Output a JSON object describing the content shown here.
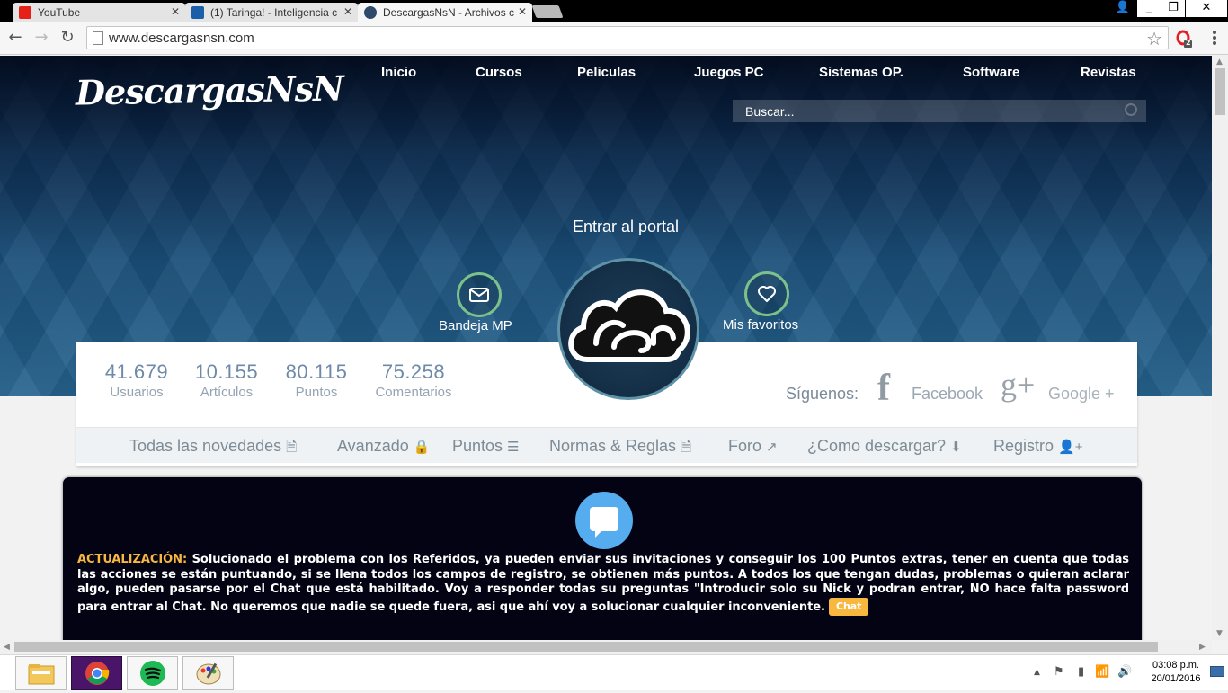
{
  "browser": {
    "tabs": [
      {
        "label": "YouTube",
        "favicon_color": "#e62117"
      },
      {
        "label": "(1) Taringa! - Inteligencia c",
        "favicon_color": "#1a5fa8"
      },
      {
        "label": "DescargasNsN - Archivos c",
        "favicon_color": "#2f4a6b"
      }
    ],
    "url": "www.descargasnsn.com",
    "extension_badge": "2"
  },
  "site": {
    "logo": "DescargasNsN",
    "nav": [
      "Inicio",
      "Cursos",
      "Peliculas",
      "Juegos PC",
      "Sistemas OP.",
      "Software",
      "Revistas"
    ],
    "search_placeholder": "Buscar...",
    "hero_title": "Entrar al portal",
    "hero_left_label": "Bandeja MP",
    "hero_right_label": "Mis favoritos",
    "accent": "#7cc08a"
  },
  "stats": [
    {
      "value": "41.679",
      "label": "Usuarios"
    },
    {
      "value": "10.155",
      "label": "Artículos"
    },
    {
      "value": "80.115",
      "label": "Puntos"
    },
    {
      "value": "75.258",
      "label": "Comentarios"
    }
  ],
  "social": {
    "follow": "Síguenos:",
    "facebook_icon": "f",
    "facebook": "Facebook",
    "google_icon": "g+",
    "google": "Google +"
  },
  "subnav": [
    {
      "label": "Todas las novedades",
      "glyph": "🗎"
    },
    {
      "label": "Avanzado",
      "glyph": "🔒"
    },
    {
      "label": "Puntos",
      "glyph": "☰"
    },
    {
      "label": "Normas & Reglas",
      "glyph": "🗎"
    },
    {
      "label": "Foro",
      "glyph": "↗"
    },
    {
      "label": "¿Como descargar?",
      "glyph": "⬇"
    },
    {
      "label": "Registro",
      "glyph": "👤+"
    }
  ],
  "notice": {
    "heading": "ACTUALIZACIÓN:",
    "body": " Solucionado el problema con los Referidos, ya pueden enviar sus invitaciones y conseguir los 100 Puntos extras, tener en cuenta que todas las acciones se están puntuando, si se llena todos los campos de registro, se obtienen más puntos. A todos los que tengan dudas, problemas o quieran aclarar algo, pueden pasarse por el Chat que está habilitado. Voy a responder todas su preguntas \"Introducir solo su Nick y podran entrar, NO hace falta password para entrar al Chat. No queremos que nadie se quede fuera, asi que ahí voy a solucionar cualquier inconveniente.",
    "chat_button": "Chat",
    "highlight_color": "#f8b840"
  },
  "taskbar": {
    "apps": [
      "file-explorer-icon",
      "chrome-icon",
      "spotify-icon",
      "paint-icon"
    ],
    "time": "03:08 p.m.",
    "date": "20/01/2016"
  }
}
